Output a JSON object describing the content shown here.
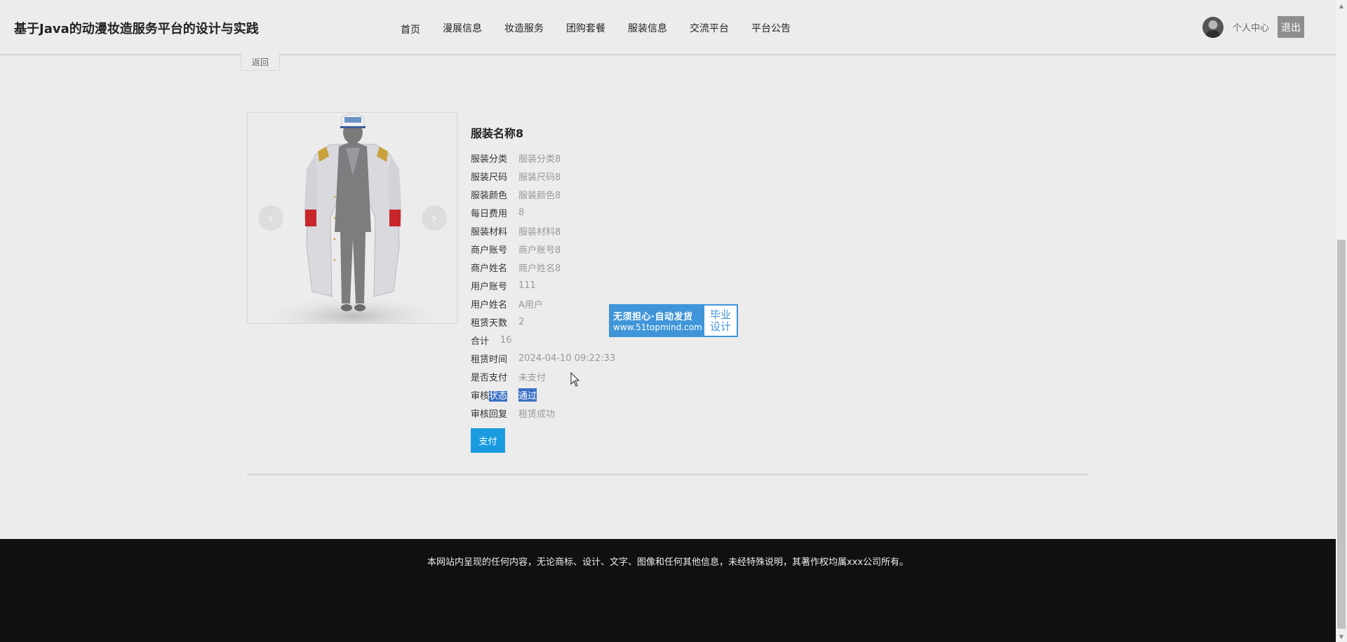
{
  "header": {
    "site_title": "基于Java的动漫妆造服务平台的设计与实践",
    "nav": [
      "首页",
      "漫展信息",
      "妆造服务",
      "团购套餐",
      "服装信息",
      "交流平台",
      "平台公告"
    ],
    "profile_label": "个人中心",
    "logout_label": "退出"
  },
  "back_label": "返回",
  "carousel": {
    "prev_glyph": "‹",
    "next_glyph": "›"
  },
  "product": {
    "name": "服装名称8",
    "fields": [
      {
        "label": "服装分类",
        "value": "服装分类8"
      },
      {
        "label": "服装尺码",
        "value": "服装尺码8"
      },
      {
        "label": "服装颜色",
        "value": "服装颜色8"
      },
      {
        "label": "每日费用",
        "value": "8"
      },
      {
        "label": "服装材料",
        "value": "服装材料8"
      },
      {
        "label": "商户账号",
        "value": "商户账号8"
      },
      {
        "label": "商户姓名",
        "value": "商户姓名8"
      },
      {
        "label": "用户账号",
        "value": "111"
      },
      {
        "label": "用户姓名",
        "value": "A用户"
      },
      {
        "label": "租赁天数",
        "value": "2"
      },
      {
        "label": "合计",
        "value": "16"
      },
      {
        "label": "租赁时间",
        "value": "2024-04-10 09:22:33"
      },
      {
        "label": "是否支付",
        "value": "未支付"
      },
      {
        "label_a": "审核",
        "label_b": "状态",
        "value": "通过"
      },
      {
        "label": "审核回复",
        "value": "租赁成功"
      }
    ],
    "pay_label": "支付"
  },
  "badge": {
    "line1": "无须担心·自动发货",
    "line2": "www.51topmind.com",
    "right1": "毕业",
    "right2": "设计"
  },
  "footer_text": "本网站内呈现的任何内容，无论商标、设计、文字、图像和任何其他信息，未经特殊说明，其著作权均属xxx公司所有。",
  "scrollbar": {
    "up_glyph": "▲",
    "down_glyph": "▼"
  },
  "colors": {
    "pay_button": "#1a9be0",
    "highlight": "#3a6fc4",
    "footer_bg": "#101010",
    "badge_blue": "#3f95d8"
  }
}
